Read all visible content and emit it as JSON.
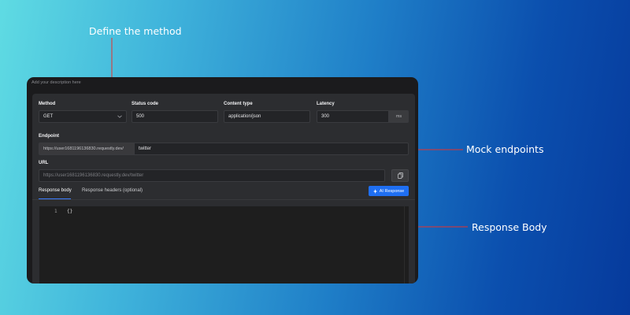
{
  "callouts": {
    "method": "Define the method",
    "endpoints": "Mock endpoints",
    "body": "Response Body"
  },
  "description_placeholder": "Add your description here",
  "form": {
    "method": {
      "label": "Method",
      "value": "GET"
    },
    "status_code": {
      "label": "Status code",
      "value": "500"
    },
    "content_type": {
      "label": "Content type",
      "value": "application/json"
    },
    "latency": {
      "label": "Latency",
      "value": "300",
      "unit": "ms"
    },
    "endpoint": {
      "label": "Endpoint",
      "prefix": "https://user1681196136830.requestly.dev/",
      "value": "twitter"
    },
    "url": {
      "label": "URL",
      "value": "https://user1681196136830.requestly.dev/twitter"
    }
  },
  "tabs": [
    {
      "label": "Response body",
      "active": true
    },
    {
      "label": "Response headers (optional)",
      "active": false
    }
  ],
  "ai_button": {
    "label": "AI Response"
  },
  "editor": {
    "line_numbers": [
      "1"
    ],
    "lines": [
      "{}"
    ]
  },
  "colors": {
    "arrow": "#e5322d",
    "accent": "#1f6ff2"
  }
}
